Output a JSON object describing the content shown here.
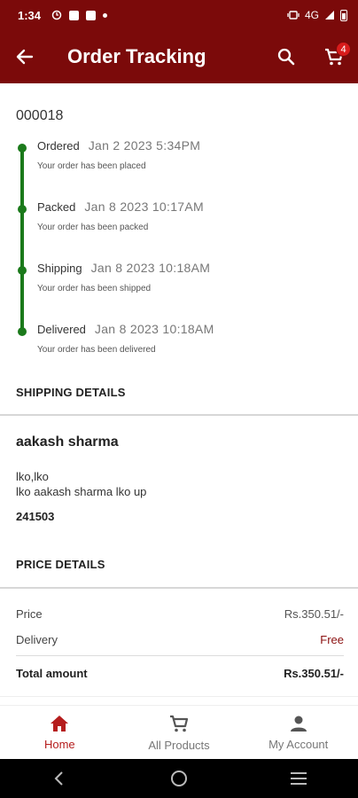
{
  "status_bar": {
    "time": "1:34",
    "network": "4G"
  },
  "app_bar": {
    "title": "Order Tracking",
    "cart_count": "4"
  },
  "order": {
    "id": "000018"
  },
  "timeline": [
    {
      "label": "Ordered",
      "date": "Jan  2 2023  5:34PM",
      "desc": "Your order has been placed"
    },
    {
      "label": "Packed",
      "date": "Jan  8 2023 10:17AM",
      "desc": "Your order has been packed"
    },
    {
      "label": "Shipping",
      "date": "Jan  8 2023 10:18AM",
      "desc": "Your order has been shipped"
    },
    {
      "label": "Delivered",
      "date": "Jan  8 2023 10:18AM",
      "desc": "Your order has been delivered"
    }
  ],
  "shipping": {
    "title": "SHIPPING DETAILS",
    "name": "aakash sharma",
    "line1": "lko,lko",
    "line2": "lko aakash sharma lko up",
    "zip": "241503"
  },
  "price": {
    "title": "PRICE DETAILS",
    "price_label": "Price",
    "price_value": "Rs.350.51/-",
    "delivery_label": "Delivery",
    "delivery_value": "Free",
    "total_label": "Total amount",
    "total_value": "Rs.350.51/-"
  },
  "bottom_nav": [
    {
      "label": "Home",
      "icon": "home-icon"
    },
    {
      "label": "All Products",
      "icon": "cart-icon"
    },
    {
      "label": "My Account",
      "icon": "person-icon"
    }
  ],
  "colors": {
    "primary": "#7b0a0a",
    "accent": "#b51d1d",
    "timeline": "#1b7a1b"
  }
}
